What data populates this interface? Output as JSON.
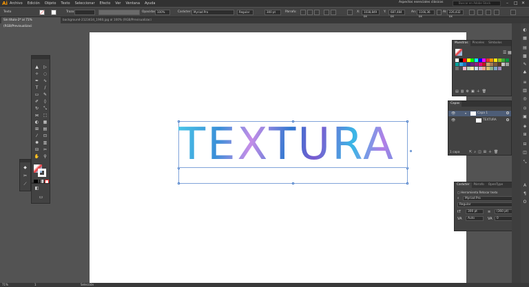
{
  "app": {
    "logo": "Ai"
  },
  "menu": [
    "Archivo",
    "Edición",
    "Objeto",
    "Texto",
    "Seleccionar",
    "Efecto",
    "Ver",
    "Ventana",
    "Ayuda"
  ],
  "workspace": "Aspectos esenciales clásicos",
  "search_placeholder": "Buscar en Adobe Stock",
  "control": {
    "type_label": "Texto",
    "stroke_label": "Trazo:",
    "opacity_label": "Opacidad:",
    "opacity_value": "100%",
    "char_label": "Carácter:",
    "font": "Myriad Pro",
    "style": "Regular",
    "size": "300 pt",
    "para_label": "Párrafo:",
    "x": "1038,849 px",
    "y": "687,484 px",
    "w": "1166,36 px",
    "h": "226,432 px"
  },
  "tabs": [
    {
      "label": "Sin título-2* al 71% (RGB/Previsualizaci"
    },
    {
      "label": "background-2123434_1960.jpg al 100% (RGB/Previsualizaci"
    }
  ],
  "artwork_text": "TEXTURA",
  "swatches_panel": {
    "tabs": [
      "Muestras",
      "Pinceles",
      "Símbolos"
    ]
  },
  "swatch_colors": [
    "#ffffff",
    "#000000",
    "#ff0000",
    "#ffff00",
    "#00ff00",
    "#00ffff",
    "#0000ff",
    "#ff00ff",
    "#e6332a",
    "#f39200",
    "#fcea10",
    "#95c11f",
    "#3aaa35",
    "#009640",
    "#00a19a",
    "#36a9e1",
    "#1d71b8",
    "#2d2e83",
    "#662483",
    "#951b81",
    "#e5007d",
    "#be1622",
    "#c9a66b",
    "#a47a52",
    "#7e5a3b",
    "#5c3a20",
    "#c6c6c6",
    "#9d9d9d",
    "#706f6f",
    "#4b4b4d",
    "#f5b6cd",
    "#b8d8be",
    "#fce8a8",
    "#c7e0f4",
    "#d0b4d8",
    "#f0a38c",
    "#d9c06f",
    "#8fb38a",
    "#7ea6c9",
    "#a08bc0"
  ],
  "layers_panel": {
    "title": "Capas",
    "layer": "Capa 1",
    "sublayer": "TEXTURA",
    "count": "1 capa"
  },
  "char_panel": {
    "tabs": [
      "Carácter",
      "Párrafo",
      "OpenType"
    ],
    "touch_tool": "Herramienta Retocar texto",
    "font": "Myriad Pro",
    "style": "Regular",
    "size": "300 pt",
    "leading": "(360 pt)",
    "kerning": "Auto",
    "tracking": "0"
  },
  "status": {
    "zoom": "71%",
    "page": "1",
    "mode": "Selección"
  }
}
